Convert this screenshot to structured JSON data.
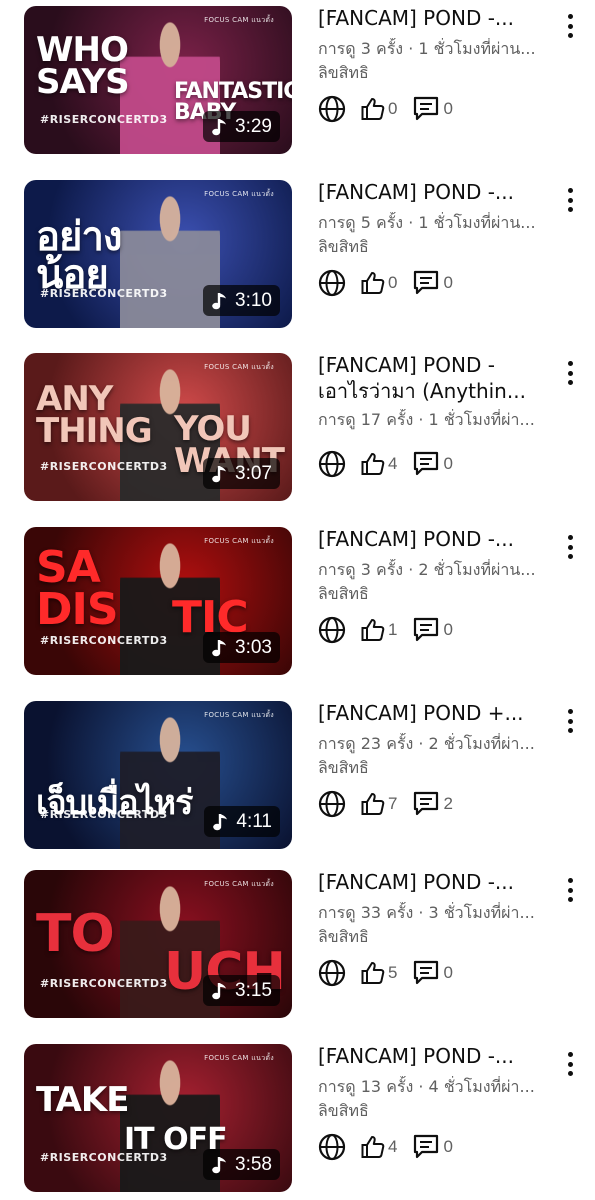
{
  "videos": [
    {
      "title_line1": "[FANCAM] POND -...",
      "title_line2": "",
      "views": "การดู 3 ครั้ง · 1 ชั่วโมงที่ผ่าน...",
      "status": "ลิขสิทธิ",
      "likes": "0",
      "comments": "0",
      "duration": "3:29",
      "thumb_text": "WHO\nSAYS",
      "thumb_text2": "FANTASTIC\nBABY",
      "thumb_tag": "#RISERCONCERTD3",
      "thumb_top": "FOCUS CAM แนวตั้ง",
      "colors": {
        "bg1": "#2a0d1c",
        "bg2": "#7a2148",
        "text": "#ffffff",
        "person": "#c14a8a"
      }
    },
    {
      "title_line1": "[FANCAM] POND -...",
      "title_line2": "",
      "views": "การดู 5 ครั้ง · 1 ชั่วโมงที่ผ่าน...",
      "status": "ลิขสิทธิ",
      "likes": "0",
      "comments": "0",
      "duration": "3:10",
      "thumb_text": "อย่าง\nน้อย",
      "thumb_text2": "",
      "thumb_tag": "#RISERCONCERTD3",
      "thumb_top": "FOCUS CAM แนวตั้ง",
      "colors": {
        "bg1": "#0d1a4a",
        "bg2": "#3b4fb0",
        "text": "#ffffff",
        "person": "#8a8a9a"
      }
    },
    {
      "title_line1": "[FANCAM] POND -",
      "title_line2": "เอาไรว่ามา (Anythin...",
      "views": "การดู 17 ครั้ง · 1 ชั่วโมงที่ผ่า...",
      "status": "",
      "likes": "4",
      "comments": "0",
      "duration": "3:07",
      "thumb_text": "ANY\nTHING",
      "thumb_text2": "YOU\nWANT",
      "thumb_tag": "#RISERCONCERTD3",
      "thumb_top": "FOCUS CAM แนวตั้ง",
      "colors": {
        "bg1": "#5a1a1a",
        "bg2": "#d04a4a",
        "text": "#f1c6b8",
        "person": "#2b2b2b"
      }
    },
    {
      "title_line1": "[FANCAM] POND -...",
      "title_line2": "",
      "views": "การดู 3 ครั้ง · 2 ชั่วโมงที่ผ่าน...",
      "status": "ลิขสิทธิ",
      "likes": "1",
      "comments": "0",
      "duration": "3:03",
      "thumb_text": "SA\nDIS",
      "thumb_text2": "TIC",
      "thumb_tag": "#RISERCONCERTD3",
      "thumb_top": "FOCUS CAM แนวตั้ง",
      "colors": {
        "bg1": "#3a0606",
        "bg2": "#b00f0f",
        "text": "#ff2a2a",
        "person": "#1a1a1a"
      }
    },
    {
      "title_line1": "[FANCAM] POND +...",
      "title_line2": "",
      "views": "การดู 23 ครั้ง · 2 ชั่วโมงที่ผ่า...",
      "status": "ลิขสิทธิ",
      "likes": "7",
      "comments": "2",
      "duration": "4:11",
      "thumb_text": "เจ็บเมื่อไหร่",
      "thumb_text2": "",
      "thumb_tag": "#RISERCONCERTD3",
      "thumb_top": "FOCUS CAM แนวตั้ง",
      "colors": {
        "bg1": "#0a1230",
        "bg2": "#274f8f",
        "text": "#ffffff",
        "person": "#1e1e2a"
      }
    },
    {
      "title_line1": "[FANCAM] POND -...",
      "title_line2": "",
      "views": "การดู 33 ครั้ง · 3 ชั่วโมงที่ผ่า...",
      "status": "ลิขสิทธิ",
      "likes": "5",
      "comments": "0",
      "duration": "3:15",
      "thumb_text": "TO",
      "thumb_text2": "UCH",
      "thumb_tag": "#RISERCONCERTD3",
      "thumb_top": "FOCUS CAM แนวตั้ง",
      "colors": {
        "bg1": "#2a0608",
        "bg2": "#8a1020",
        "text": "#e8303c",
        "person": "#3a1a1a"
      }
    },
    {
      "title_line1": "[FANCAM] POND -...",
      "title_line2": "",
      "views": "การดู 13 ครั้ง · 4 ชั่วโมงที่ผ่า...",
      "status": "ลิขสิทธิ",
      "likes": "4",
      "comments": "0",
      "duration": "3:58",
      "thumb_text": "TAKE",
      "thumb_text2": "IT OFF",
      "thumb_tag": "#RISERCONCERTD3",
      "thumb_top": "FOCUS CAM แนวตั้ง",
      "colors": {
        "bg1": "#3a0a10",
        "bg2": "#a52030",
        "text": "#ffffff",
        "person": "#1a1a1a"
      }
    }
  ],
  "icons": {
    "more": "more-vertical-icon",
    "visibility": "globe-icon",
    "like": "thumbs-up-icon",
    "comment": "comment-icon",
    "duration": "music-note-icon"
  }
}
